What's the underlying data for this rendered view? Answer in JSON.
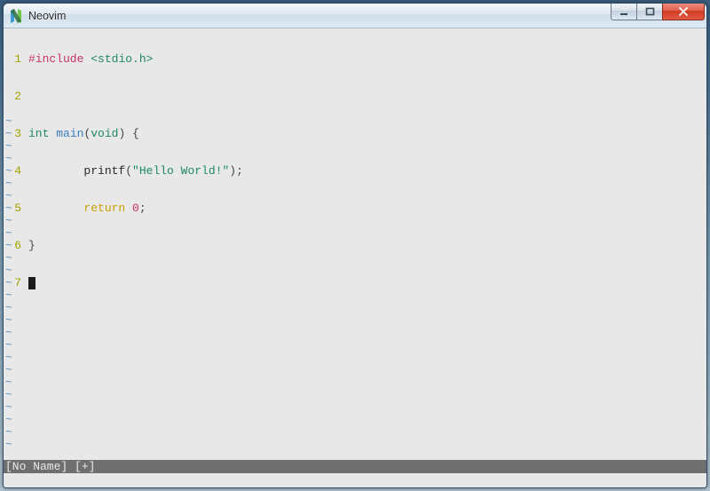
{
  "window": {
    "title": "Neovim"
  },
  "editor": {
    "line_numbers": [
      "1",
      "2",
      "3",
      "4",
      "5",
      "6",
      "7"
    ],
    "code": {
      "l1_preproc": "#include",
      "l1_space": " ",
      "l1_header": "<stdio.h>",
      "l3_type": "int",
      "l3_sp1": " ",
      "l3_func": "main",
      "l3_paren_o": "(",
      "l3_void": "void",
      "l3_paren_c": ")",
      "l3_sp2": " ",
      "l3_brace": "{",
      "l4_indent": "        ",
      "l4_call": "printf",
      "l4_paren_o": "(",
      "l4_str": "\"Hello World!\"",
      "l4_paren_c": ")",
      "l4_semi": ";",
      "l5_indent": "        ",
      "l5_ret": "return",
      "l5_sp": " ",
      "l5_zero": "0",
      "l5_semi": ";",
      "l6_brace": "}"
    },
    "tilde": "~"
  },
  "status": {
    "text": "[No Name]  [+]"
  }
}
